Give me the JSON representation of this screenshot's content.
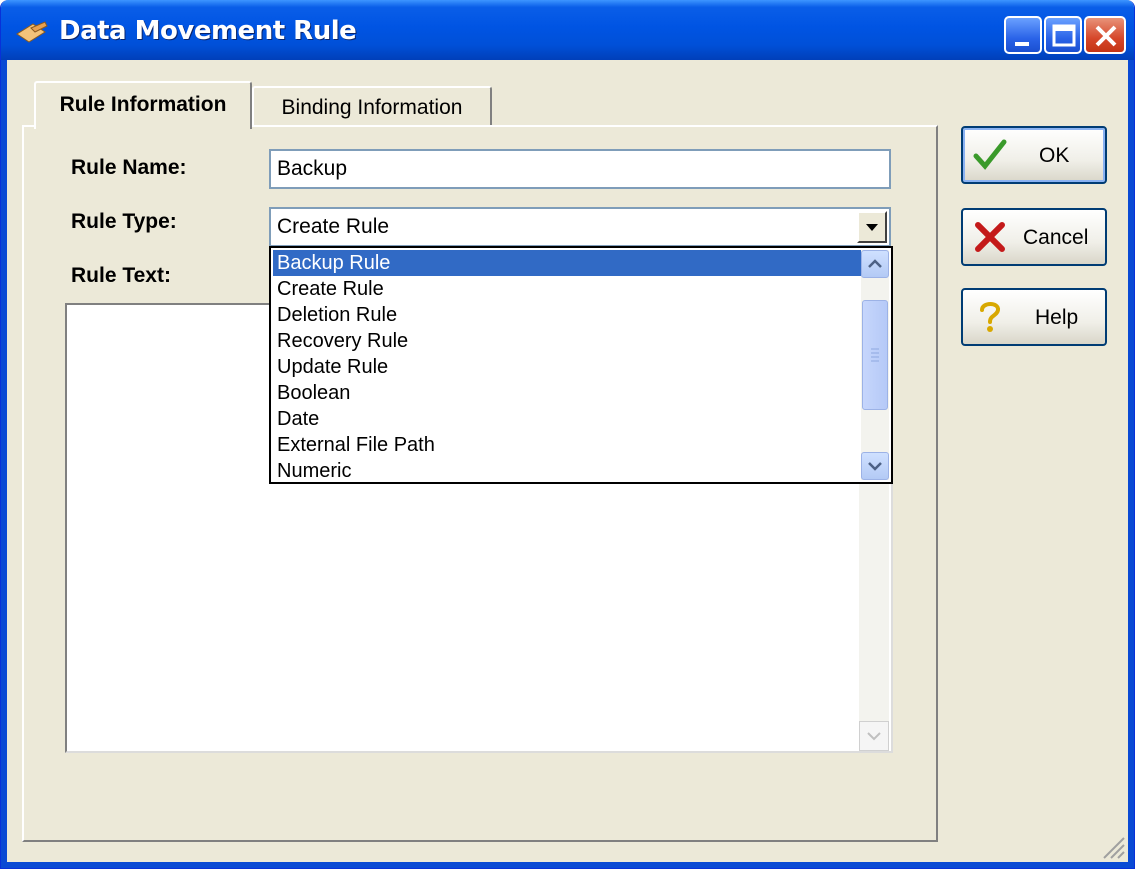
{
  "window": {
    "title": "Data Movement Rule"
  },
  "tabs": [
    {
      "label": "Rule Information",
      "active": true
    },
    {
      "label": "Binding Information",
      "active": false
    }
  ],
  "form": {
    "rule_name_label": "Rule Name:",
    "rule_name_value": "Backup",
    "rule_type_label": "Rule Type:",
    "rule_type_value": "Create Rule",
    "rule_text_label": "Rule Text:"
  },
  "dropdown": {
    "items": [
      {
        "label": "Backup Rule",
        "selected": true
      },
      {
        "label": "Create Rule"
      },
      {
        "label": "Deletion Rule"
      },
      {
        "label": "Recovery Rule"
      },
      {
        "label": "Update Rule"
      },
      {
        "label": "Boolean"
      },
      {
        "label": "Date"
      },
      {
        "label": "External File Path"
      },
      {
        "label": "Numeric"
      }
    ]
  },
  "buttons": {
    "ok": "OK",
    "cancel": "Cancel",
    "help": "Help"
  },
  "colors": {
    "selection": "#316ac5",
    "titlebar": "#0054e3",
    "dialog_bg": "#ece9d8"
  }
}
